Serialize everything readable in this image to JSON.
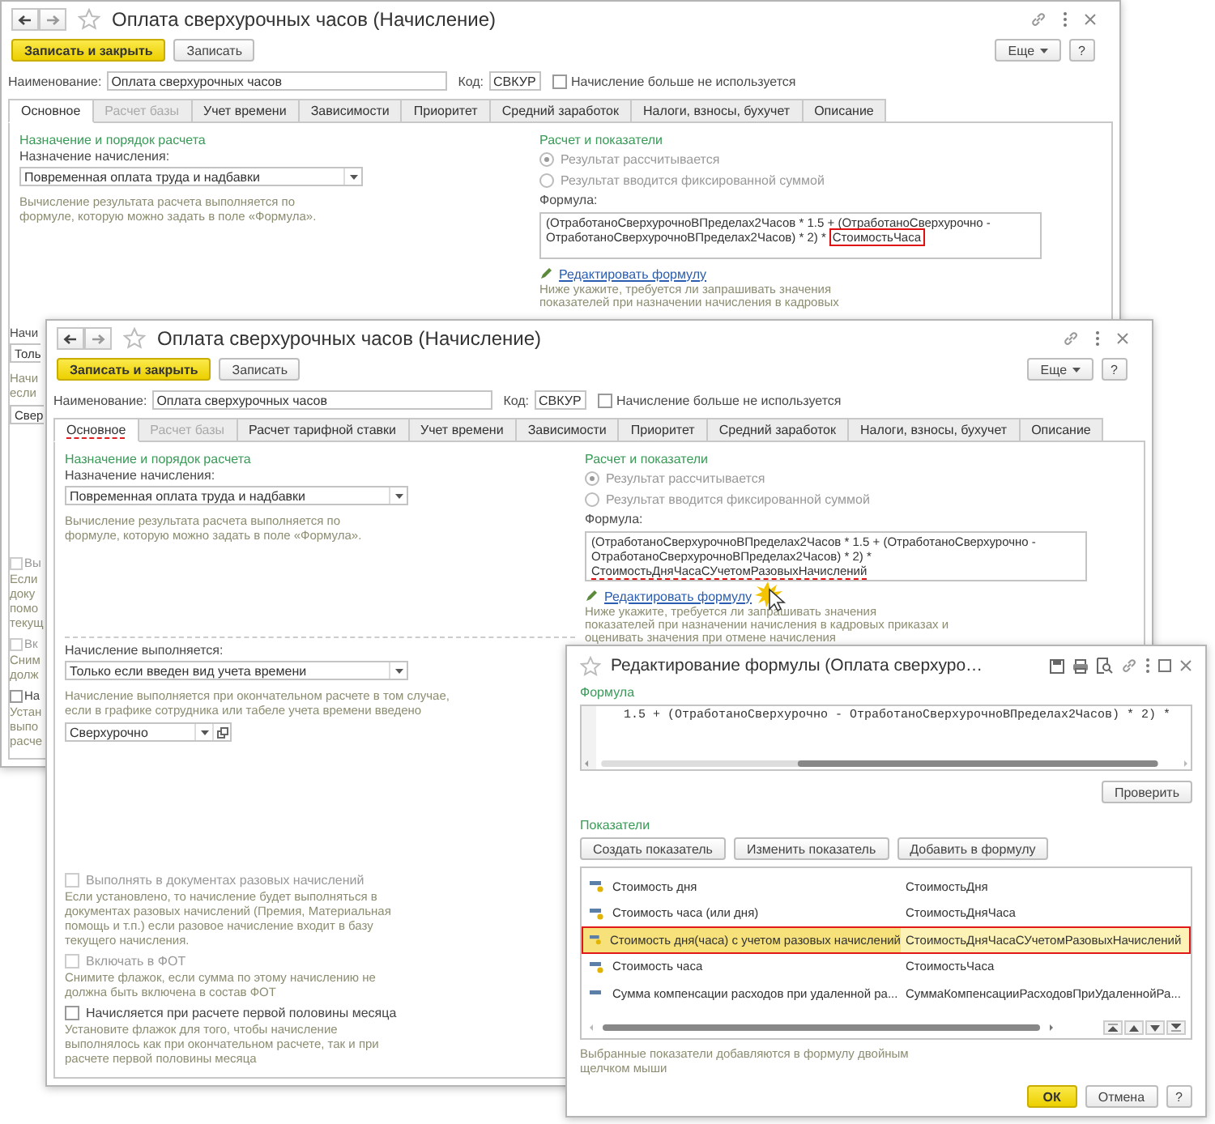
{
  "main_window": {
    "title": "Оплата сверхурочных часов (Начисление)",
    "buttons": [
      {
        "label": "Записать и закрыть",
        "kind": "primary"
      },
      {
        "label": "Записать",
        "kind": "normal"
      }
    ],
    "more": "Еще",
    "help": "?",
    "name_label": "Наименование:",
    "name_value": "Оплата сверхурочных часов",
    "code_label": "Код:",
    "code_value": "СВКУР",
    "unused": {
      "label": "Начисление больше не используется",
      "checked": false
    },
    "tabs": [
      {
        "label": "Основное",
        "selected": true,
        "disabled": false,
        "underlined": false
      },
      {
        "label": "Расчет базы",
        "selected": false,
        "disabled": true,
        "underlined": false
      },
      {
        "label": "Учет времени",
        "selected": false,
        "disabled": false,
        "underlined": false
      },
      {
        "label": "Зависимости",
        "selected": false,
        "disabled": false,
        "underlined": false
      },
      {
        "label": "Приоритет",
        "selected": false,
        "disabled": false,
        "underlined": false
      },
      {
        "label": "Средний заработок",
        "selected": false,
        "disabled": false,
        "underlined": false
      },
      {
        "label": "Налоги, взносы, бухучет",
        "selected": false,
        "disabled": false,
        "underlined": false
      },
      {
        "label": "Описание",
        "selected": false,
        "disabled": false,
        "underlined": false
      }
    ],
    "left": {
      "title": "Назначение и порядок расчета",
      "label": "Назначение начисления:",
      "value": "Повременная оплата труда и надбавки",
      "hint": "Вычисление результата расчета выполняется по формуле, которую можно задать в поле «Формула»."
    },
    "right": {
      "title": "Расчет и показатели",
      "radios": [
        {
          "label": "Результат рассчитывается",
          "selected": true,
          "disabled": true
        },
        {
          "label": "Результат вводится фиксированной суммой",
          "selected": false,
          "disabled": true
        }
      ],
      "formula_label": "Формула:",
      "formula": [
        {
          "text": "(ОтработаноСверхурочноВПределах2Часов * 1.5 + (ОтработаноСверхурочно -",
          "boxed": false,
          "underlined": false
        },
        {
          "text": "ОтработаноСверхурочноВПределах2Часов) * 2) *",
          "boxed": false,
          "underlined": false
        },
        {
          "text": "СтоимостьЧаса",
          "boxed": true,
          "underlined": false
        }
      ],
      "edit_link": "Редактировать формулу",
      "note": "Ниже укажите, требуется ли запрашивать значения показателей при назначении начисления в кадровых"
    },
    "lower_cut": {
      "label": "Начи",
      "value": "Толь",
      "hint_lines": [
        "Начи",
        "если"
      ],
      "time_type": "Свер",
      "checkboxes": [
        {
          "label": "Вы",
          "checked": false,
          "disabled": true,
          "hint_lines": [
            "Если",
            "доку",
            "помо",
            "текущ"
          ]
        },
        {
          "label": "Вк",
          "checked": false,
          "disabled": true,
          "hint_lines": [
            "Сним",
            "долж"
          ]
        },
        {
          "label": "На",
          "checked": false,
          "disabled": false,
          "hint_lines": [
            "Устан",
            "выпо",
            "расче"
          ]
        }
      ]
    }
  },
  "copy_window": {
    "title": "Оплата сверхурочных часов (Начисление)",
    "buttons": [
      {
        "label": "Записать и закрыть",
        "kind": "primary"
      },
      {
        "label": "Записать",
        "kind": "normal"
      }
    ],
    "more": "Еще",
    "help": "?",
    "name_label": "Наименование:",
    "name_value": "Оплата сверхурочных часов",
    "code_label": "Код:",
    "code_value": "СВКУР",
    "unused": {
      "label": "Начисление больше не используется",
      "checked": false
    },
    "tabs": [
      {
        "label": "Основное",
        "selected": true,
        "disabled": false,
        "underlined": true
      },
      {
        "label": "Расчет базы",
        "selected": false,
        "disabled": true,
        "underlined": false
      },
      {
        "label": "Расчет тарифной ставки",
        "selected": false,
        "disabled": false,
        "underlined": false
      },
      {
        "label": "Учет времени",
        "selected": false,
        "disabled": false,
        "underlined": false
      },
      {
        "label": "Зависимости",
        "selected": false,
        "disabled": false,
        "underlined": false
      },
      {
        "label": "Приоритет",
        "selected": false,
        "disabled": false,
        "underlined": false
      },
      {
        "label": "Средний заработок",
        "selected": false,
        "disabled": false,
        "underlined": false
      },
      {
        "label": "Налоги, взносы, бухучет",
        "selected": false,
        "disabled": false,
        "underlined": false
      },
      {
        "label": "Описание",
        "selected": false,
        "disabled": false,
        "underlined": false
      }
    ],
    "left": {
      "title": "Назначение и порядок расчета",
      "label": "Назначение начисления:",
      "value": "Повременная оплата труда и надбавки",
      "hint": "Вычисление результата расчета выполняется по формуле, которую можно задать в поле «Формула»."
    },
    "right": {
      "title": "Расчет и показатели",
      "radios": [
        {
          "label": "Результат рассчитывается",
          "selected": true,
          "disabled": true
        },
        {
          "label": "Результат вводится фиксированной суммой",
          "selected": false,
          "disabled": true
        }
      ],
      "formula_label": "Формула:",
      "formula": [
        {
          "text": "(ОтработаноСверхурочноВПределах2Часов * 1.5 + (ОтработаноСверхурочно -",
          "boxed": false,
          "underlined": false
        },
        {
          "text": "ОтработаноСверхурочноВПределах2Часов) * 2) *",
          "boxed": false,
          "underlined": false
        },
        {
          "text": "СтоимостьДняЧасаСУчетомРазовыхНачислений",
          "boxed": false,
          "underlined": true
        }
      ],
      "edit_link": "Редактировать формулу",
      "note": "Ниже укажите, требуется ли запрашивать значения показателей при назначении начисления в кадровых приказах и оценивать значения при отмене начисления"
    },
    "lower": {
      "label": "Начисление выполняется:",
      "value": "Только если введен вид учета времени",
      "hint": "Начисление выполняется при окончательном расчете в том случае, если в графике сотрудника или табеле учета времени введено",
      "time_type": "Сверхурочно",
      "checkboxes": [
        {
          "label": "Выполнять в документах разовых начислений",
          "checked": false,
          "disabled": true,
          "hint": "Если установлено, то начисление будет выполняться в документах разовых начислений (Премия, Материальная помощь и т.п.) если разовое начисление входит в базу текущего начисления."
        },
        {
          "label": "Включать в ФОТ",
          "checked": false,
          "disabled": true,
          "hint": "Снимите флажок, если сумма по этому начислению не должна быть включена в состав ФОТ"
        },
        {
          "label": "Начисляется при расчете первой половины месяца",
          "checked": false,
          "disabled": false,
          "hint": "Установите флажок для того, чтобы начисление выполнялось как при окончательном расчете, так и при расчете первой половины месяца"
        }
      ]
    }
  },
  "formula_dialog": {
    "title": "Редактирование формулы (Оплата сверхуро…",
    "formula_label": "Формула",
    "code": "1.5 + (ОтработаноСверхурочно - ОтработаноСверхурочноВПределах2Часов) * 2) *",
    "check_button": "Проверить",
    "indicators_label": "Показатели",
    "buttons": [
      "Создать показатель",
      "Изменить показатель",
      "Добавить в формулу"
    ],
    "rows": [
      {
        "name": "Стоимость дня",
        "id": "СтоимостьДня",
        "kind": "computed",
        "selected": false
      },
      {
        "name": "Стоимость часа (или дня)",
        "id": "СтоимостьДняЧаса",
        "kind": "computed",
        "selected": false
      },
      {
        "name": "Стоимость дня(часа) с учетом разовых начислений",
        "id": "СтоимостьДняЧасаСУчетомРазовыхНачислений",
        "kind": "computed",
        "selected": true
      },
      {
        "name": "Стоимость часа",
        "id": "СтоимостьЧаса",
        "kind": "computed",
        "selected": false
      },
      {
        "name": "Сумма компенсации расходов при удаленной ра...",
        "id": "СуммаКомпенсацииРасходовПриУдаленнойРа...",
        "kind": "plain",
        "selected": false
      }
    ],
    "note": "Выбранные показатели добавляются в формулу двойным щелчком мыши",
    "ok": "ОК",
    "cancel": "Отмена",
    "help": "?"
  }
}
